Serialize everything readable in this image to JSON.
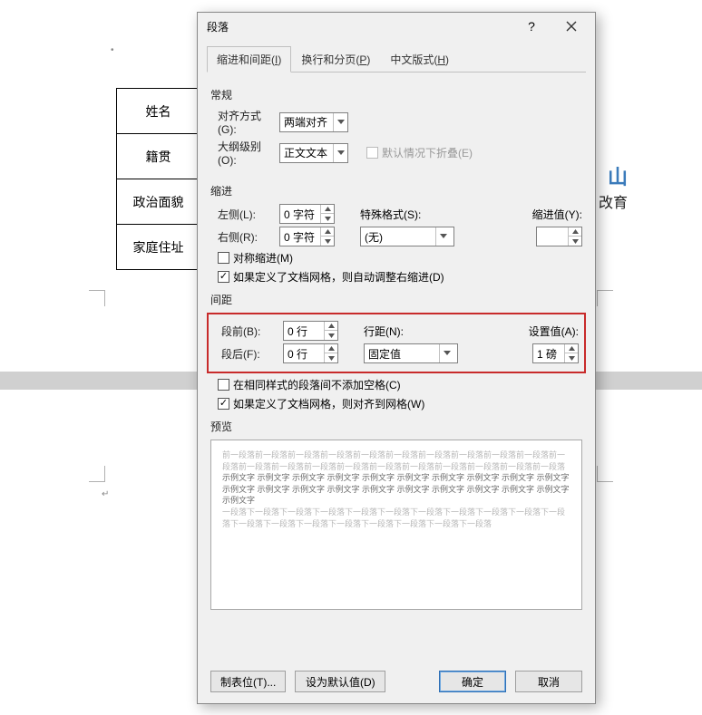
{
  "bg": {
    "rows": [
      "姓名",
      "籍贯",
      "政治面貌",
      "家庭住址"
    ],
    "logo_chars": "山",
    "logo_sub": "改育"
  },
  "dialog": {
    "title": "段落",
    "tabs": [
      {
        "label": "缩进和间距(",
        "key": "I",
        "suffix": ")"
      },
      {
        "label": "换行和分页(",
        "key": "P",
        "suffix": ")"
      },
      {
        "label": "中文版式(",
        "key": "H",
        "suffix": ")"
      }
    ],
    "section_general": "常规",
    "alignment_label": "对齐方式(G):",
    "alignment_value": "两端对齐",
    "outline_label": "大纲级别(O):",
    "outline_value": "正文文本",
    "collapse_label": "默认情况下折叠(E)",
    "section_indent": "缩进",
    "left_label": "左侧(L):",
    "left_value": "0 字符",
    "right_label": "右侧(R):",
    "right_value": "0 字符",
    "special_label": "特殊格式(S):",
    "special_value": "(无)",
    "indent_by_label": "缩进值(Y):",
    "indent_by_value": "",
    "mirror_label": "对称缩进(M)",
    "grid_indent_label": "如果定义了文档网格，则自动调整右缩进(D)",
    "section_spacing": "间距",
    "before_label": "段前(B):",
    "before_value": "0 行",
    "after_label": "段后(F):",
    "after_value": "0 行",
    "linespacing_label": "行距(N):",
    "linespacing_value": "固定值",
    "at_label": "设置值(A):",
    "at_value": "1 磅",
    "nospace_label": "在相同样式的段落间不添加空格(C)",
    "grid_align_label": "如果定义了文档网格，则对齐到网格(W)",
    "preview_label": "预览",
    "preview_filler_pre": "前一段落前一段落前一段落前一段落前一段落前一段落前一段落前一段落前一段落前一段落前一段落前一段落前一段落前一段落前一段落前一段落前一段落前一段落前一段落前一段落前一段落",
    "preview_filler_mid": "示例文字 示例文字 示例文字 示例文字 示例文字 示例文字 示例文字 示例文字 示例文字 示例文字 示例文字 示例文字 示例文字 示例文字 示例文字 示例文字 示例文字 示例文字 示例文字 示例文字 示例文字",
    "preview_filler_post": "一段落下一段落下一段落下一段落下一段落下一段落下一段落下一段落下一段落下一段落下一段落下一段落下一段落下一段落下一段落下一段落下一段落下一段落下一段落",
    "btn_tabs": "制表位(T)...",
    "btn_default": "设为默认值(D)",
    "btn_ok": "确定",
    "btn_cancel": "取消"
  }
}
